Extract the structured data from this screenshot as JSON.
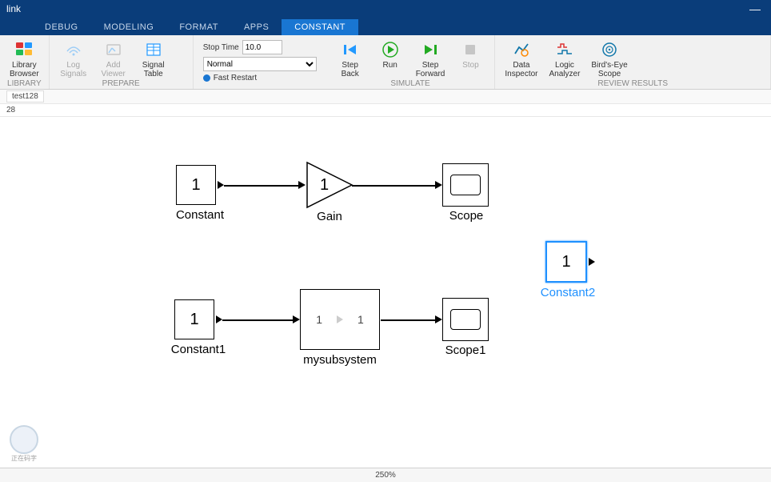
{
  "title": "link",
  "menu_tabs": [
    "DEBUG",
    "MODELING",
    "FORMAT",
    "APPS",
    "CONSTANT"
  ],
  "active_tab": "CONSTANT",
  "ribbon": {
    "library": {
      "label": "LIBRARY",
      "browser": "Library\nBrowser"
    },
    "prepare": {
      "label": "PREPARE",
      "log": "Log\nSignals",
      "viewer": "Add\nViewer",
      "table": "Signal\nTable"
    },
    "simulate": {
      "label": "SIMULATE",
      "stop_time_label": "Stop Time",
      "stop_time_value": "10.0",
      "mode": "Normal",
      "fast_restart": "Fast Restart",
      "step_back": "Step\nBack",
      "run": "Run",
      "step_forward": "Step\nForward",
      "stop": "Stop"
    },
    "review": {
      "label": "REVIEW RESULTS",
      "data_inspector": "Data\nInspector",
      "logic_analyzer": "Logic\nAnalyzer",
      "birds_eye": "Bird's-Eye\nScope"
    }
  },
  "breadcrumb": "test128",
  "model_path": "28",
  "blocks": {
    "constant": {
      "value": "1",
      "label": "Constant"
    },
    "gain": {
      "value": "1",
      "label": "Gain"
    },
    "scope": {
      "label": "Scope"
    },
    "constant1": {
      "value": "1",
      "label": "Constant1"
    },
    "subsystem": {
      "in": "1",
      "out": "1",
      "label": "mysubsystem"
    },
    "scope1": {
      "label": "Scope1"
    },
    "constant2": {
      "value": "1",
      "label": "Constant2"
    }
  },
  "status": {
    "zoom": "250%"
  },
  "watermark_text": "正在码字"
}
